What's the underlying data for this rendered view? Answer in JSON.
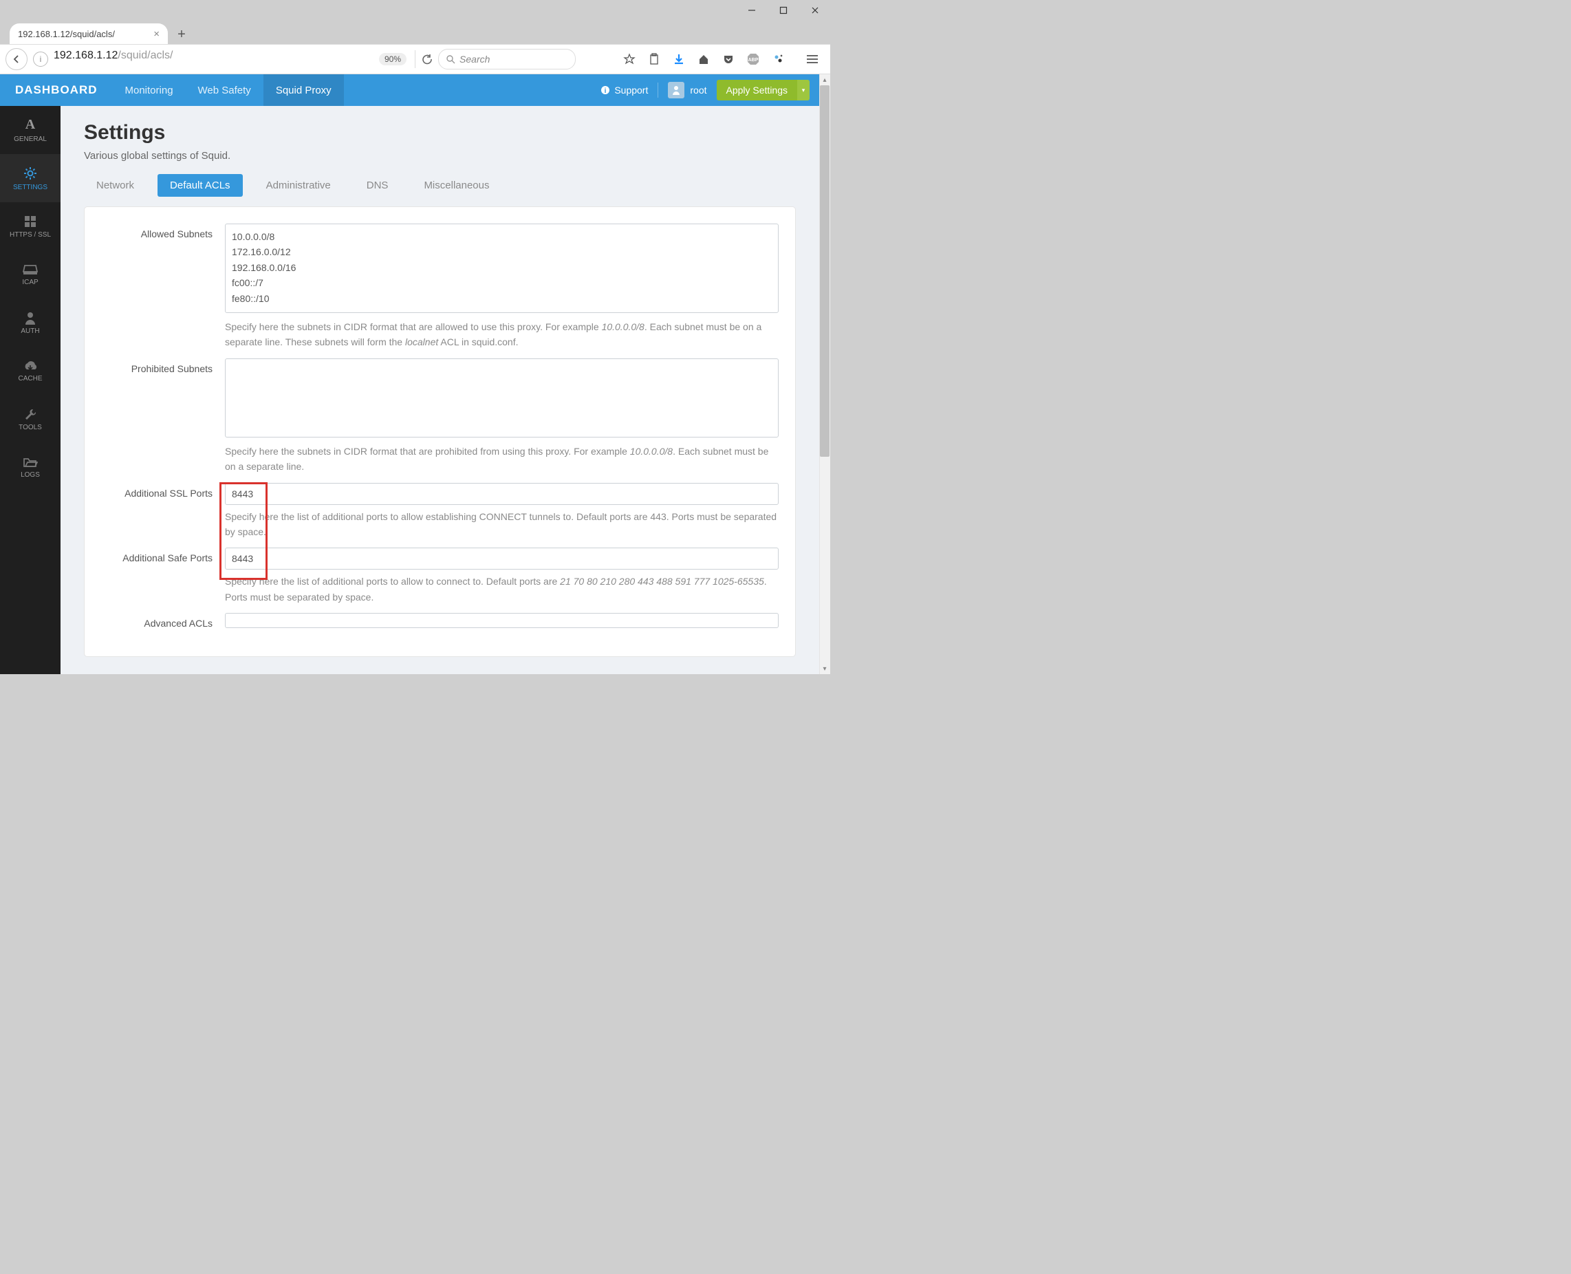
{
  "window": {
    "min": "—",
    "max": "☐",
    "close": "✕"
  },
  "browser": {
    "tab_title": "192.168.1.12/squid/acls/",
    "url_host": "192.168.1.12",
    "url_path": "/squid/acls/",
    "zoom": "90%",
    "search_placeholder": "Search"
  },
  "header": {
    "brand": "DASHBOARD",
    "nav": [
      "Monitoring",
      "Web Safety",
      "Squid Proxy"
    ],
    "active_nav": "Squid Proxy",
    "support": "Support",
    "user": "root",
    "apply": "Apply Settings"
  },
  "sidebar": [
    {
      "icon": "A",
      "label": "GENERAL"
    },
    {
      "icon": "gear",
      "label": "SETTINGS"
    },
    {
      "icon": "grid",
      "label": "HTTPS / SSL"
    },
    {
      "icon": "tray",
      "label": "ICAP"
    },
    {
      "icon": "user",
      "label": "AUTH"
    },
    {
      "icon": "cloud",
      "label": "CACHE"
    },
    {
      "icon": "wrench",
      "label": "TOOLS"
    },
    {
      "icon": "folder",
      "label": "LOGS"
    }
  ],
  "sidebar_active": 1,
  "page": {
    "title": "Settings",
    "subtitle": "Various global settings of Squid.",
    "tabs": [
      "Network",
      "Default ACLs",
      "Administrative",
      "DNS",
      "Miscellaneous"
    ],
    "active_tab": "Default ACLs"
  },
  "form": {
    "allowed_label": "Allowed Subnets",
    "allowed_value": "10.0.0.0/8\n172.16.0.0/12\n192.168.0.0/16\nfc00::/7\nfe80::/10",
    "allowed_help_a": "Specify here the subnets in CIDR format that are allowed to use this proxy. For example ",
    "allowed_help_em1": "10.0.0.0/8",
    "allowed_help_b": ". Each subnet must be on a separate line. These subnets will form the ",
    "allowed_help_em2": "localnet",
    "allowed_help_c": " ACL in squid.conf.",
    "prohibited_label": "Prohibited Subnets",
    "prohibited_value": "",
    "prohibited_help_a": "Specify here the subnets in CIDR format that are prohibited from using this proxy. For example ",
    "prohibited_help_em": "10.0.0.0/8",
    "prohibited_help_b": ". Each subnet must be on a separate line.",
    "sslports_label": "Additional SSL Ports",
    "sslports_value": "8443",
    "sslports_help": "Specify here the list of additional ports to allow establishing CONNECT tunnels to. Default ports are 443. Ports must be separated by space.",
    "safeports_label": "Additional Safe Ports",
    "safeports_value": "8443",
    "safeports_help_a": "Specify here the list of additional ports to allow to connect to. Default ports are ",
    "safeports_help_em": "21 70 80 210 280 443 488 591 777 1025-65535",
    "safeports_help_b": ". Ports must be separated by space.",
    "advacls_label": "Advanced ACLs"
  }
}
